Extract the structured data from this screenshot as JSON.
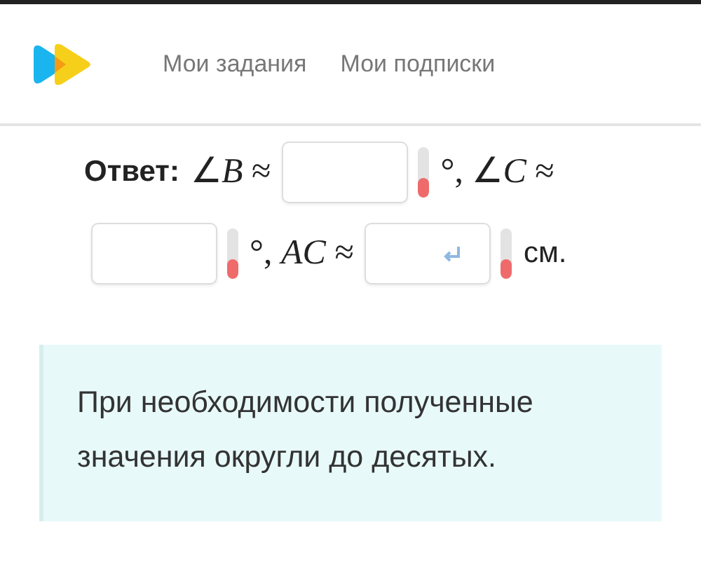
{
  "nav": {
    "links": [
      {
        "label": "Мои задания",
        "selected": false
      },
      {
        "label": "Мои подписки",
        "selected": false
      }
    ]
  },
  "answer": {
    "lines": [
      [
        {
          "kind": "label",
          "text": "Ответ:"
        },
        {
          "kind": "math",
          "text": "∠*B* ≈"
        },
        {
          "kind": "input",
          "level": 0.4
        },
        {
          "kind": "math",
          "text": "°, ∠*C* ≈"
        }
      ],
      [
        {
          "kind": "input",
          "level": 0.4
        },
        {
          "kind": "math",
          "text": "°, *AC* ≈"
        },
        {
          "kind": "input-enter",
          "level": 0.4
        },
        {
          "kind": "text",
          "text": "см."
        }
      ]
    ]
  },
  "note": {
    "text": "При необходимости полученные значения округли до десятых."
  }
}
